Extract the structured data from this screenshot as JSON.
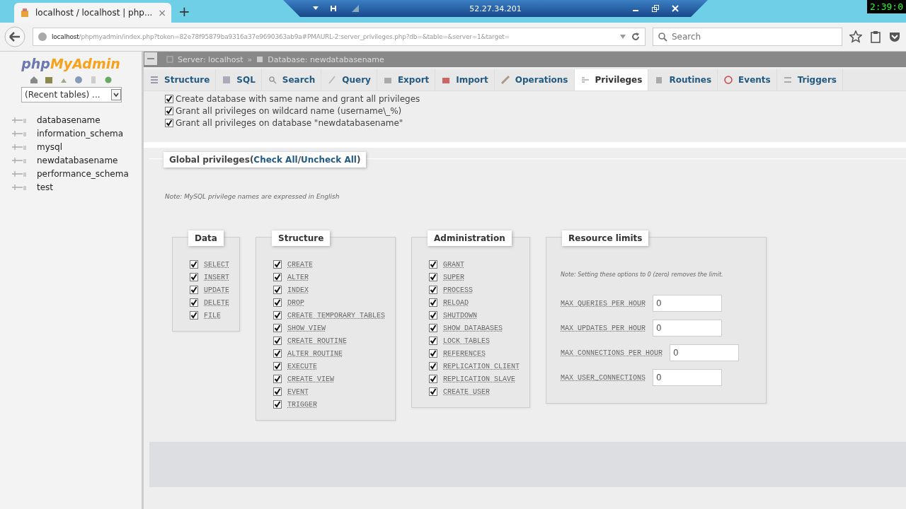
{
  "browser": {
    "tab_title": "localhost / localhost | php...",
    "tab_close": "×",
    "new_tab": "+",
    "url_host": "localhost",
    "url_path": "/phpmyadmin/index.php?token=82e78f95879ba9316a37e9690363ab9a#PMAURL-2:server_privileges.php?db=&table=&server=1&target=",
    "search_placeholder": "Search"
  },
  "remote_bar": {
    "host": "52.27.34.201"
  },
  "clock": "2:39:0",
  "sidebar": {
    "logo_php": "php",
    "logo_myadmin": "MyAdmin",
    "recent_tables": "(Recent tables) ...",
    "databases": [
      {
        "name": "databasename"
      },
      {
        "name": "information_schema"
      },
      {
        "name": "mysql"
      },
      {
        "name": "newdatabasename"
      },
      {
        "name": "performance_schema"
      },
      {
        "name": "test"
      }
    ]
  },
  "breadcrumb": {
    "server": "Server: localhost",
    "separator": "»",
    "database": "Database: newdatabasename"
  },
  "tabs": [
    {
      "label": "Structure",
      "selected": false
    },
    {
      "label": "SQL",
      "selected": false
    },
    {
      "label": "Search",
      "selected": false
    },
    {
      "label": "Query",
      "selected": false
    },
    {
      "label": "Export",
      "selected": false
    },
    {
      "label": "Import",
      "selected": false
    },
    {
      "label": "Operations",
      "selected": false
    },
    {
      "label": "Privileges",
      "selected": true
    },
    {
      "label": "Routines",
      "selected": false
    },
    {
      "label": "Events",
      "selected": false
    },
    {
      "label": "Triggers",
      "selected": false
    }
  ],
  "options": [
    {
      "label": "Create database with same name and grant all privileges",
      "checked": true
    },
    {
      "label": "Grant all privileges on wildcard name (username\\_%)",
      "checked": true
    },
    {
      "label": "Grant all privileges on database \"newdatabasename\"",
      "checked": true
    }
  ],
  "global_privileges": {
    "title": "Global privileges",
    "open": "(",
    "check_all": "Check All",
    "separator": " /",
    "uncheck_all": "Uncheck All",
    "close": ")",
    "note": "Note: MySQL privilege names are expressed in English"
  },
  "groups": [
    {
      "title": "Data",
      "kind": "checks",
      "items": [
        {
          "label": "SELECT",
          "checked": true
        },
        {
          "label": "INSERT",
          "checked": true
        },
        {
          "label": "UPDATE",
          "checked": true
        },
        {
          "label": "DELETE",
          "checked": true
        },
        {
          "label": "FILE",
          "checked": true
        }
      ]
    },
    {
      "title": "Structure",
      "kind": "checks",
      "items": [
        {
          "label": "CREATE",
          "checked": true
        },
        {
          "label": "ALTER",
          "checked": true
        },
        {
          "label": "INDEX",
          "checked": true
        },
        {
          "label": "DROP",
          "checked": true
        },
        {
          "label": "CREATE TEMPORARY TABLES",
          "checked": true
        },
        {
          "label": "SHOW VIEW",
          "checked": true
        },
        {
          "label": "CREATE ROUTINE",
          "checked": true
        },
        {
          "label": "ALTER ROUTINE",
          "checked": true
        },
        {
          "label": "EXECUTE",
          "checked": true
        },
        {
          "label": "CREATE VIEW",
          "checked": true
        },
        {
          "label": "EVENT",
          "checked": true
        },
        {
          "label": "TRIGGER",
          "checked": true
        }
      ]
    },
    {
      "title": "Administration",
      "kind": "checks",
      "items": [
        {
          "label": "GRANT",
          "checked": true
        },
        {
          "label": "SUPER",
          "checked": true
        },
        {
          "label": "PROCESS",
          "checked": true
        },
        {
          "label": "RELOAD",
          "checked": true
        },
        {
          "label": "SHUTDOWN",
          "checked": true
        },
        {
          "label": "SHOW DATABASES",
          "checked": true
        },
        {
          "label": "LOCK TABLES",
          "checked": true
        },
        {
          "label": "REFERENCES",
          "checked": true
        },
        {
          "label": "REPLICATION CLIENT",
          "checked": true
        },
        {
          "label": "REPLICATION SLAVE",
          "checked": true
        },
        {
          "label": "CREATE USER",
          "checked": true
        }
      ]
    },
    {
      "title": "Resource limits",
      "kind": "limits",
      "note": "Note: Setting these options to 0 (zero) removes the limit.",
      "fields": [
        {
          "label": "MAX QUERIES PER HOUR",
          "value": "0"
        },
        {
          "label": "MAX UPDATES PER HOUR",
          "value": "0"
        },
        {
          "label": "MAX CONNECTIONS PER HOUR",
          "value": "0"
        },
        {
          "label": "MAX USER_CONNECTIONS",
          "value": "0"
        }
      ]
    }
  ]
}
